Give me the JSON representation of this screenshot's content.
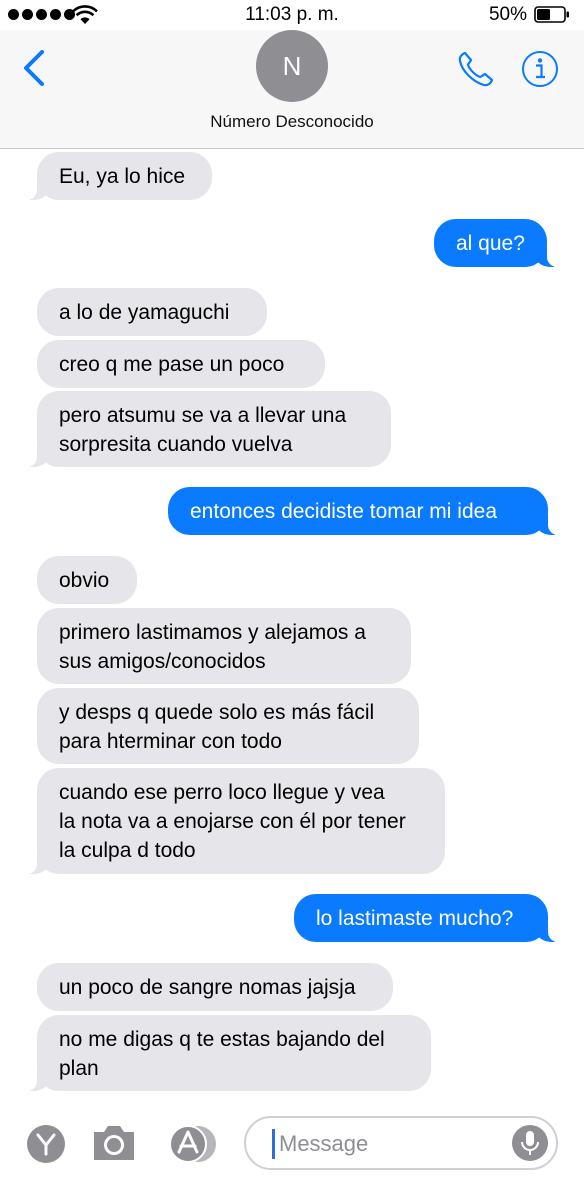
{
  "status_bar": {
    "time": "11:03 p. m.",
    "battery": "50%"
  },
  "header": {
    "avatar_initial": "N",
    "contact_name": "Número Desconocido",
    "accent_color": "#0a7aff"
  },
  "messages": [
    {
      "from": "them",
      "text": "Eu, ya lo hice"
    },
    {
      "from": "me",
      "text": "al que?"
    },
    {
      "from": "them",
      "text": "a lo de yamaguchi"
    },
    {
      "from": "them",
      "text": "creo q me pase un poco"
    },
    {
      "from": "them",
      "text": "pero atsumu se va a llevar  una\nsorpresita cuando vuelva"
    },
    {
      "from": "me",
      "text": "entonces decidiste tomar mi idea"
    },
    {
      "from": "them",
      "text": "obvio"
    },
    {
      "from": "them",
      "text": "primero lastimamos y alejamos a\nsus amigos/conocidos"
    },
    {
      "from": "them",
      "text": "y desps q quede solo es más fácil\npara hterminar con todo"
    },
    {
      "from": "them",
      "text": "cuando ese perro loco llegue y vea\nla nota va a enojarse con él por tener\nla culpa d todo"
    },
    {
      "from": "me",
      "text": "lo lastimaste mucho?"
    },
    {
      "from": "them",
      "text": "un poco de sangre nomas jajsja"
    },
    {
      "from": "them",
      "text": "no me digas q te estas bajando del\nplan"
    }
  ],
  "input_bar": {
    "placeholder": "Message",
    "icons": [
      "memoji-icon",
      "camera-icon",
      "app-store-icon",
      "microphone-icon"
    ]
  }
}
